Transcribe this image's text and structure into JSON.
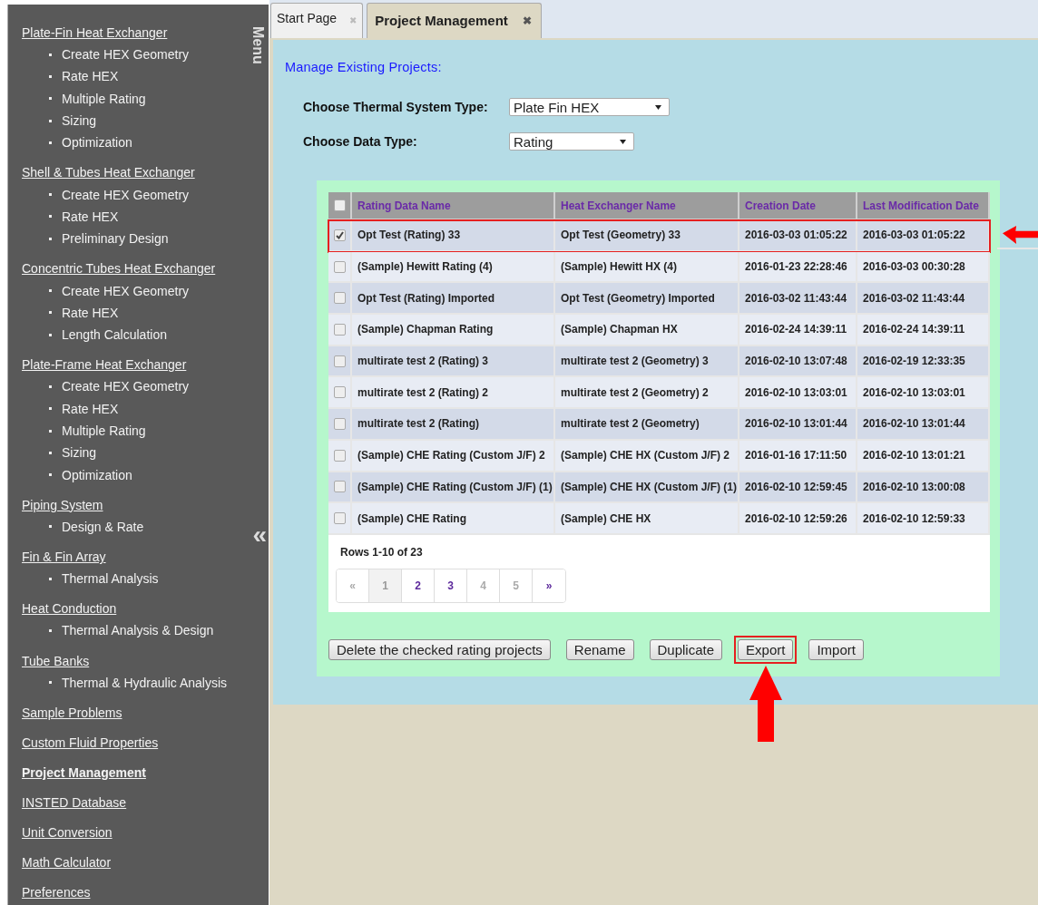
{
  "sidebar": {
    "menu_label": "Menu",
    "collapse": "«",
    "items": [
      {
        "label": "Plate-Fin Heat Exchanger",
        "selected": false,
        "children": [
          {
            "label": "Create HEX Geometry"
          },
          {
            "label": "Rate HEX"
          },
          {
            "label": "Multiple Rating"
          },
          {
            "label": "Sizing"
          },
          {
            "label": "Optimization"
          }
        ]
      },
      {
        "label": "Shell & Tubes Heat Exchanger",
        "selected": false,
        "children": [
          {
            "label": "Create HEX Geometry"
          },
          {
            "label": "Rate HEX"
          },
          {
            "label": "Preliminary Design"
          }
        ]
      },
      {
        "label": "Concentric Tubes Heat Exchanger",
        "selected": false,
        "children": [
          {
            "label": "Create HEX Geometry"
          },
          {
            "label": "Rate HEX"
          },
          {
            "label": "Length Calculation"
          }
        ]
      },
      {
        "label": "Plate-Frame Heat Exchanger",
        "selected": false,
        "children": [
          {
            "label": "Create HEX Geometry"
          },
          {
            "label": "Rate HEX"
          },
          {
            "label": "Multiple Rating"
          },
          {
            "label": "Sizing"
          },
          {
            "label": "Optimization"
          }
        ]
      },
      {
        "label": "Piping System",
        "selected": false,
        "children": [
          {
            "label": "Design & Rate"
          }
        ]
      },
      {
        "label": "Fin & Fin Array",
        "selected": false,
        "children": [
          {
            "label": "Thermal Analysis"
          }
        ]
      },
      {
        "label": "Heat Conduction",
        "selected": false,
        "children": [
          {
            "label": "Thermal Analysis & Design"
          }
        ]
      },
      {
        "label": "Tube Banks",
        "selected": false,
        "children": [
          {
            "label": "Thermal & Hydraulic Analysis"
          }
        ]
      },
      {
        "label": "Sample Problems",
        "selected": false
      },
      {
        "label": "Custom Fluid Properties",
        "selected": false
      },
      {
        "label": "Project Management",
        "selected": true
      },
      {
        "label": "INSTED Database",
        "selected": false
      },
      {
        "label": "Unit Conversion",
        "selected": false
      },
      {
        "label": "Math Calculator",
        "selected": false
      },
      {
        "label": "Preferences",
        "selected": false
      }
    ]
  },
  "tabs": [
    {
      "label": "Start Page",
      "close": "✖",
      "selected": false
    },
    {
      "label": "Project Management",
      "close": "✖",
      "selected": true
    }
  ],
  "panel": {
    "title": "Manage Existing Projects:",
    "fields": [
      {
        "label": "Choose Thermal System Type:",
        "value": "Plate Fin HEX"
      },
      {
        "label": "Choose Data Type:",
        "value": "Rating"
      }
    ]
  },
  "table": {
    "select_all_checked": false,
    "columns": [
      "Rating Data Name",
      "Heat Exchanger Name",
      "Creation Date",
      "Last Modification Date"
    ],
    "rows": [
      {
        "checked": true,
        "highlighted": true,
        "cells": [
          "Opt Test (Rating) 33",
          "Opt Test (Geometry) 33",
          "2016-03-03 01:05:22",
          "2016-03-03 01:05:22"
        ]
      },
      {
        "checked": false,
        "highlighted": false,
        "cells": [
          "(Sample) Hewitt Rating (4)",
          "(Sample) Hewitt HX (4)",
          "2016-01-23 22:28:46",
          "2016-03-03 00:30:28"
        ]
      },
      {
        "checked": false,
        "highlighted": false,
        "cells": [
          "Opt Test (Rating) Imported",
          "Opt Test (Geometry) Imported",
          "2016-03-02 11:43:44",
          "2016-03-02 11:43:44"
        ]
      },
      {
        "checked": false,
        "highlighted": false,
        "cells": [
          "(Sample) Chapman Rating",
          "(Sample) Chapman HX",
          "2016-02-24 14:39:11",
          "2016-02-24 14:39:11"
        ]
      },
      {
        "checked": false,
        "highlighted": false,
        "cells": [
          "multirate test 2 (Rating) 3",
          "multirate test 2 (Geometry) 3",
          "2016-02-10 13:07:48",
          "2016-02-19 12:33:35"
        ]
      },
      {
        "checked": false,
        "highlighted": false,
        "cells": [
          "multirate test 2 (Rating) 2",
          "multirate test 2 (Geometry) 2",
          "2016-02-10 13:03:01",
          "2016-02-10 13:03:01"
        ]
      },
      {
        "checked": false,
        "highlighted": false,
        "cells": [
          "multirate test 2 (Rating)",
          "multirate test 2 (Geometry)",
          "2016-02-10 13:01:44",
          "2016-02-10 13:01:44"
        ]
      },
      {
        "checked": false,
        "highlighted": false,
        "cells": [
          "(Sample) CHE Rating (Custom J/F) 2",
          "(Sample) CHE HX (Custom J/F) 2",
          "2016-01-16 17:11:50",
          "2016-02-10 13:01:21"
        ]
      },
      {
        "checked": false,
        "highlighted": false,
        "cells": [
          "(Sample) CHE Rating (Custom J/F) (1)",
          "(Sample) CHE HX (Custom J/F) (1)",
          "2016-02-10 12:59:45",
          "2016-02-10 13:00:08"
        ]
      },
      {
        "checked": false,
        "highlighted": false,
        "cells": [
          "(Sample) CHE Rating",
          "(Sample) CHE HX",
          "2016-02-10 12:59:26",
          "2016-02-10 12:59:33"
        ]
      }
    ],
    "row_count": "Rows 1-10 of 23",
    "pages": [
      {
        "label": "«",
        "selected": false,
        "disabled": true
      },
      {
        "label": "1",
        "selected": true,
        "disabled": false
      },
      {
        "label": "2",
        "selected": false,
        "disabled": false
      },
      {
        "label": "3",
        "selected": false,
        "disabled": false
      },
      {
        "label": "4",
        "selected": false,
        "disabled": true
      },
      {
        "label": "5",
        "selected": false,
        "disabled": true
      },
      {
        "label": "»",
        "selected": false,
        "disabled": false
      }
    ]
  },
  "buttons": [
    {
      "label": "Delete the checked rating projects",
      "highlighted": false
    },
    {
      "label": "Rename",
      "highlighted": false
    },
    {
      "label": "Duplicate",
      "highlighted": false
    },
    {
      "label": "Export",
      "highlighted": true
    },
    {
      "label": "Import",
      "highlighted": false
    }
  ]
}
